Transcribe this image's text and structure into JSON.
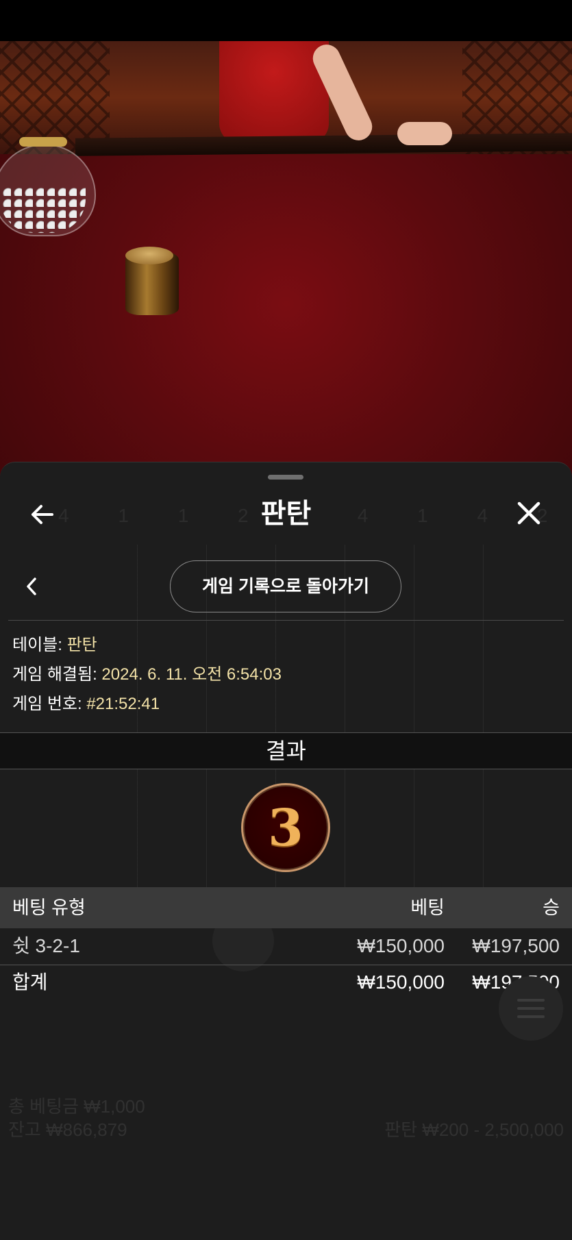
{
  "sheet": {
    "title": "판탄",
    "back_to_history": "게임 기록으로 돌아가기"
  },
  "info": {
    "table_label": "테이블:",
    "table_value": "판탄",
    "resolved_label": "게임 해결됨:",
    "resolved_value": "2024. 6. 11. 오전 6:54:03",
    "game_no_label": "게임 번호:",
    "game_no_value": "#21:52:41"
  },
  "result": {
    "heading": "결과",
    "number": "3"
  },
  "bets_table": {
    "headers": {
      "type": "베팅 유형",
      "bet": "베팅",
      "win": "승"
    },
    "rows": [
      {
        "type": "쉿 3-2-1",
        "bet": "₩150,000",
        "win": "₩197,500"
      }
    ],
    "total": {
      "label": "합계",
      "bet": "₩150,000",
      "win": "₩197,500"
    }
  },
  "background": {
    "total_bet": "총 베팅금 ₩1,000",
    "balance": "잔고 ₩866,879",
    "limits": "판탄 ₩200 - 2,500,000"
  },
  "colors": {
    "sheet_bg": "#1d1d1d",
    "value_text": "#f3e2a8",
    "header_bg": "#3a3a3a",
    "medal_border": "#c9966a",
    "felt": "#6b0b10"
  },
  "icons": {
    "back": "arrow-left-icon",
    "close": "close-icon",
    "previous": "chevron-left-icon",
    "menu": "hamburger-menu-icon"
  }
}
